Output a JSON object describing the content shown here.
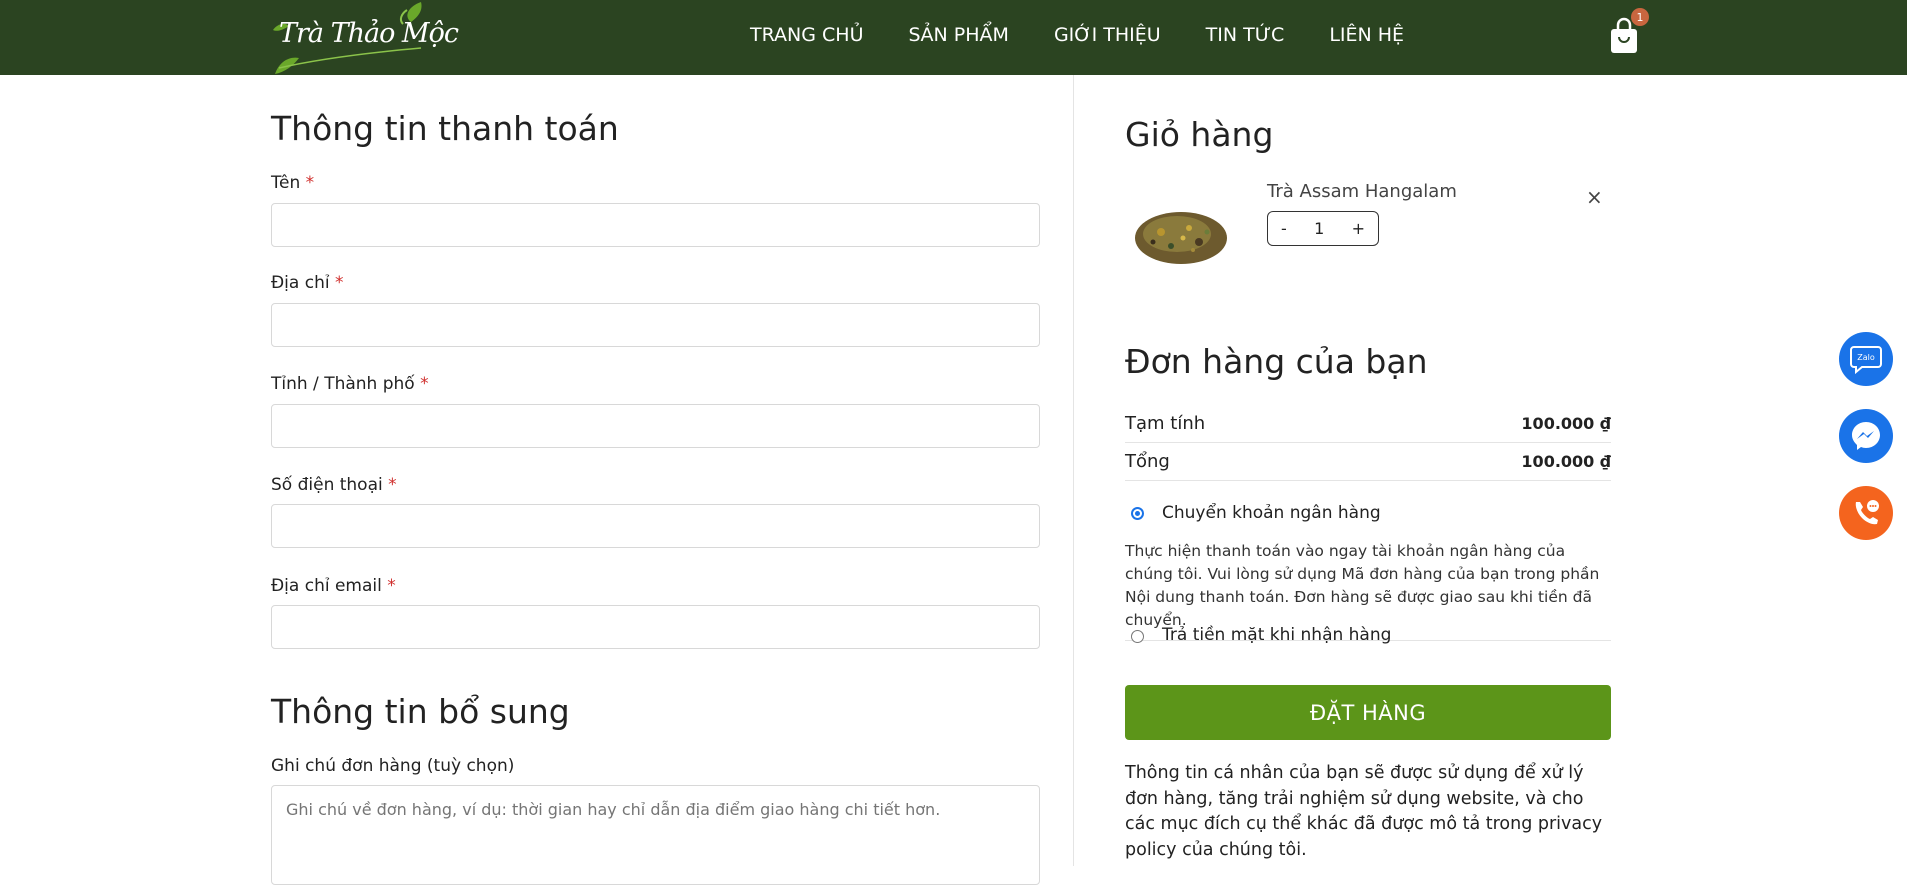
{
  "header": {
    "logo_text": "Trà Thảo Mộc",
    "nav": [
      "TRANG CHỦ",
      "SẢN PHẨM",
      "GIỚI THIỆU",
      "TIN TỨC",
      "LIÊN HỆ"
    ],
    "cart_count": "1",
    "bg_color": "#2b4421"
  },
  "billing": {
    "title": "Thông tin thanh toán",
    "fields": [
      {
        "label": "Tên",
        "required": "*"
      },
      {
        "label": "Địa chỉ",
        "required": "*"
      },
      {
        "label": "Tỉnh / Thành phố",
        "required": "*"
      },
      {
        "label": "Số điện thoại",
        "required": "*"
      },
      {
        "label": "Địa chỉ email",
        "required": "*"
      }
    ]
  },
  "extra": {
    "title": "Thông tin bổ sung",
    "notes_label": "Ghi chú đơn hàng (tuỳ chọn)",
    "notes_placeholder": "Ghi chú về đơn hàng, ví dụ: thời gian hay chỉ dẫn địa điểm giao hàng chi tiết hơn."
  },
  "cart": {
    "title": "Giỏ hàng",
    "item": {
      "name": "Trà Assam Hangalam",
      "qty": "1",
      "minus": "-",
      "plus": "+",
      "remove": "×"
    }
  },
  "order": {
    "title": "Đơn hàng của bạn",
    "subtotal_label": "Tạm tính",
    "subtotal_value": "100.000 ₫",
    "total_label": "Tổng",
    "total_value": "100.000 ₫",
    "payment_bank": "Chuyển khoản ngân hàng",
    "payment_bank_desc": "Thực hiện thanh toán vào ngay tài khoản ngân hàng của chúng tôi. Vui lòng sử dụng Mã đơn hàng của bạn trong phần Nội dung thanh toán. Đơn hàng sẽ được giao sau khi tiền đã chuyển.",
    "payment_cod": "Trả tiền mặt khi nhận hàng",
    "button": "ĐẶT HÀNG",
    "button_color": "#5c9519",
    "privacy": "Thông tin cá nhân của bạn sẽ được sử dụng để xử lý đơn hàng, tăng trải nghiệm sử dụng website, và cho các mục đích cụ thể khác đã được mô tả trong privacy policy của chúng tôi."
  },
  "floating": {
    "zalo_text": "Zalo",
    "icons": [
      "zalo-icon",
      "messenger-icon",
      "phone-icon"
    ]
  }
}
